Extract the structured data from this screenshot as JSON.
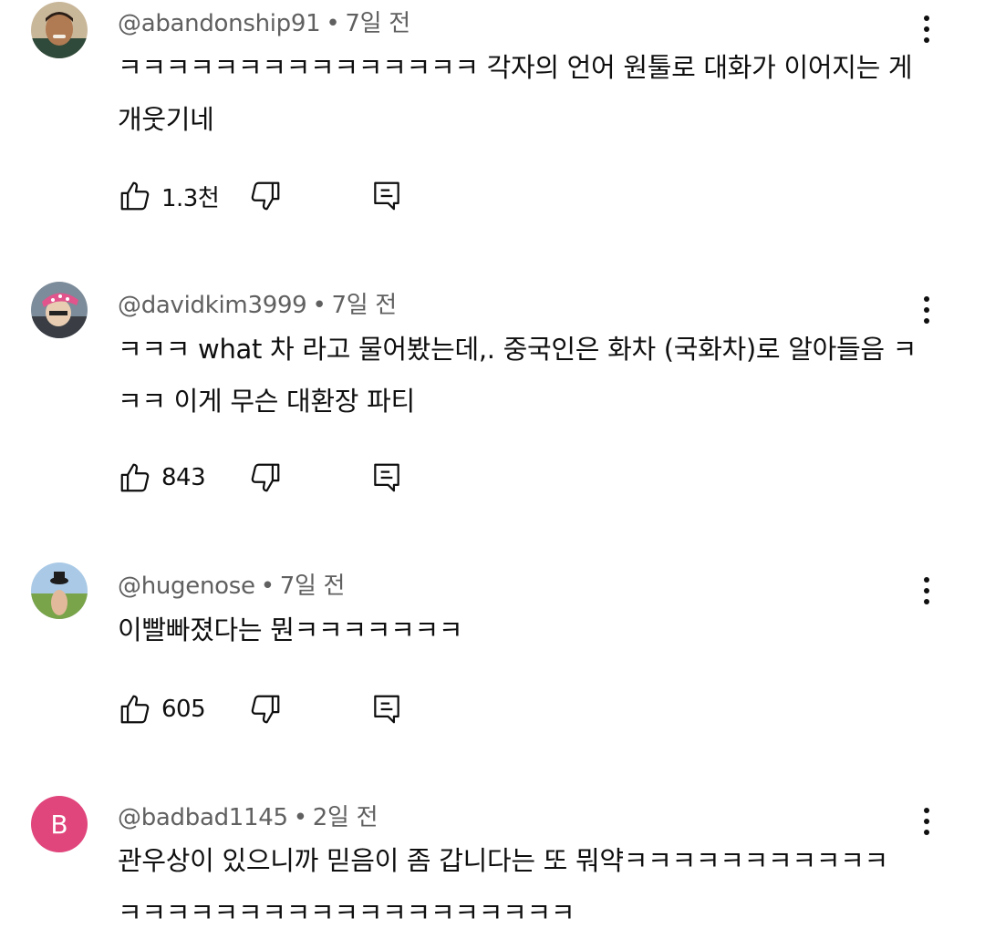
{
  "comments": [
    {
      "handle": "@abandonship91",
      "time": "7일 전",
      "text": "ㅋㅋㅋㅋㅋㅋㅋㅋㅋㅋㅋㅋㅋㅋㅋ 각자의 언어 원툴로 대화가 이어지는 게 개웃기네",
      "likes": "1.3천"
    },
    {
      "handle": "@davidkim3999",
      "time": "7일 전",
      "text": "ㅋㅋㅋ what 차 라고 물어봤는데,. 중국인은 화차 (국화차)로 알아들음 ㅋㅋㅋ 이게 무슨 대환장 파티",
      "likes": "843"
    },
    {
      "handle": "@hugenose",
      "time": "7일 전",
      "text": "이빨빠졌다는 뭔ㅋㅋㅋㅋㅋㅋㅋ",
      "likes": "605"
    },
    {
      "handle": "@badbad1145",
      "time": "2일 전",
      "avatar_letter": "B",
      "avatar_color": "#e0457b",
      "text": "관우상이 있으니까 믿음이 좀 갑니다는 또 뭐약ㅋㅋㅋㅋㅋㅋㅋㅋㅋㅋㅋ ㅋㅋㅋㅋㅋㅋㅋㅋㅋㅋㅋㅋㅋㅋㅋㅋㅋㅋㅋ"
    }
  ],
  "separator": "•",
  "icons": {
    "like": "thumbs-up-icon",
    "dislike": "thumbs-down-icon",
    "reply": "reply-icon",
    "more": "more-vert-icon"
  }
}
